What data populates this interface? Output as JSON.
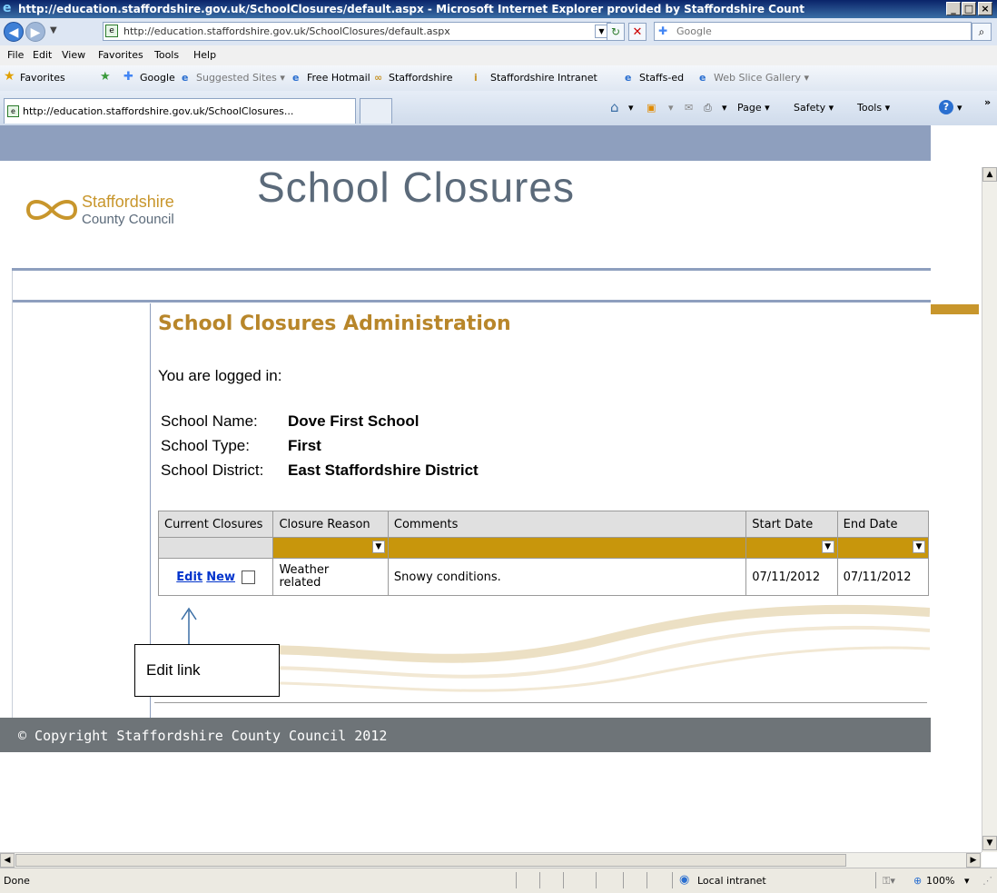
{
  "window": {
    "title": "http://education.staffordshire.gov.uk/SchoolClosures/default.aspx - Microsoft Internet Explorer provided by Staffordshire Count"
  },
  "address_bar": {
    "url": "http://education.staffordshire.gov.uk/SchoolClosures/default.aspx",
    "search_placeholder": "Google"
  },
  "menu": [
    "File",
    "Edit",
    "View",
    "Favorites",
    "Tools",
    "Help"
  ],
  "favorites_bar": {
    "favorites_label": "Favorites",
    "items": [
      "Google",
      "Suggested Sites ▾",
      "Free Hotmail",
      "Staffordshire",
      "Staffordshire Intranet",
      "Staffs-ed",
      "Web Slice Gallery ▾"
    ]
  },
  "tab": {
    "label": "http://education.staffordshire.gov.uk/SchoolClosures..."
  },
  "command_bar": {
    "page": "Page ▾",
    "safety": "Safety ▾",
    "tools": "Tools ▾"
  },
  "header": {
    "logo_line1": "Staffordshire",
    "logo_line2": "County Council",
    "site_title": "School Closures"
  },
  "main": {
    "title": "School Closures Administration",
    "logged_in": "You are logged in:",
    "school_name_label": "School Name:",
    "school_name": "Dove First School",
    "school_type_label": "School Type:",
    "school_type": "First",
    "school_district_label": "School District:",
    "school_district": "East Staffordshire District"
  },
  "table": {
    "headers": [
      "Current Closures",
      "Closure Reason",
      "Comments",
      "Start Date",
      "End Date"
    ],
    "rows": [
      {
        "edit": "Edit",
        "new": "New",
        "reason_line1": "Weather",
        "reason_line2": "related",
        "comments": "Snowy conditions.",
        "start": "07/11/2012",
        "end": "07/11/2012"
      }
    ]
  },
  "annotation": {
    "callout": "Edit link"
  },
  "footer": {
    "copyright": "© Copyright Staffordshire County Council 2012"
  },
  "status_bar": {
    "status": "Done",
    "zone": "Local intranet",
    "zoom": "100%"
  },
  "colors": {
    "accent_gold": "#b8862a",
    "filter_gold": "#c8960c",
    "header_strip": "#8e9fbe",
    "footer_gray": "#6e7478"
  }
}
